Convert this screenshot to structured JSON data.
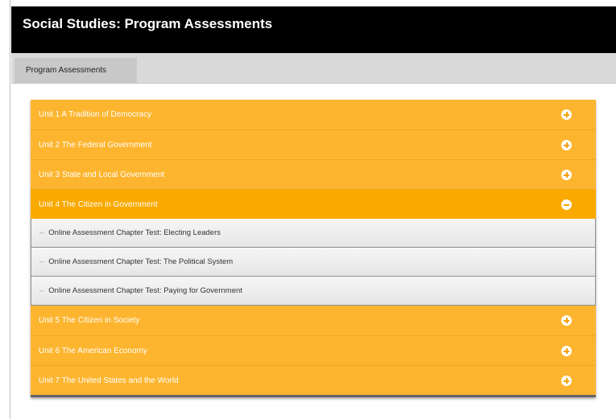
{
  "header": {
    "title": "Social Studies: Program Assessments"
  },
  "tabs": [
    {
      "label": "Program Assessments"
    }
  ],
  "units_before": [
    {
      "label": "Unit 1 A Tradition of Democracy"
    },
    {
      "label": "Unit 2 The Federal Government"
    },
    {
      "label": "Unit 3 State and Local Government"
    }
  ],
  "active_unit": {
    "label": "Unit 4 The Citizen in Government"
  },
  "sub_items": [
    {
      "dash": "–",
      "label": "Online Assessment Chapter Test: Electing Leaders"
    },
    {
      "dash": "–",
      "label": "Online Assessment Chapter Test: The Political System"
    },
    {
      "dash": "–",
      "label": "Online Assessment Chapter Test: Paying for Government"
    }
  ],
  "units_after": [
    {
      "label": "Unit 5 The Citizen in Society"
    },
    {
      "label": "Unit 6 The American Economy"
    },
    {
      "label": "Unit 7 The United States and the World"
    }
  ],
  "colors": {
    "header_bg": "#000000",
    "accent": "#fdb52f",
    "accent_active": "#f9a900"
  }
}
